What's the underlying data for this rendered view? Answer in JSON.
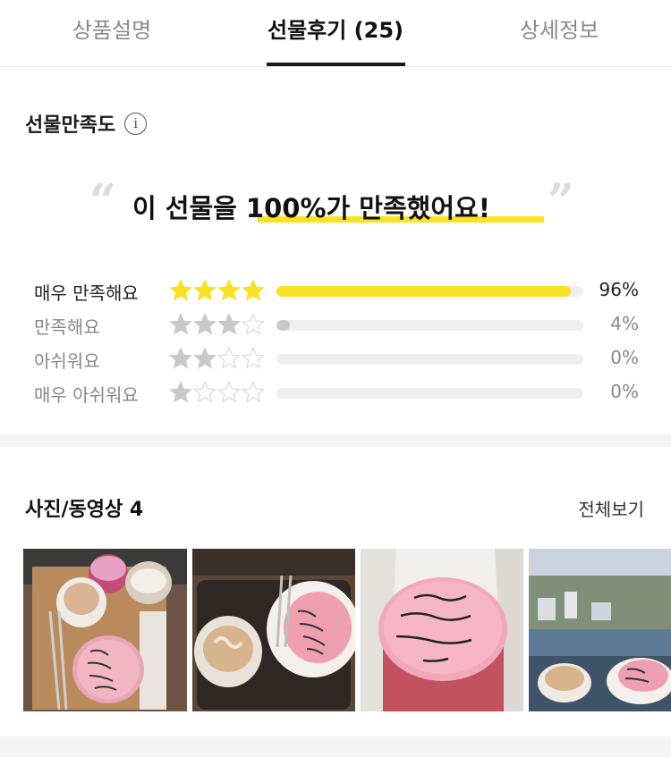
{
  "tabs": [
    {
      "label": "상품설명"
    },
    {
      "label": "선물후기 (25)"
    },
    {
      "label": "상세정보"
    }
  ],
  "satisfaction": {
    "title": "선물만족도",
    "info_icon": "info-icon",
    "headline_prefix": "이 선물을 ",
    "headline_emphasis": "100%가 만족했어요!",
    "open_quote": "“",
    "close_quote": "”",
    "accent_color": "#f7e224",
    "ratings": [
      {
        "label": "매우 만족해요",
        "stars": 4,
        "percent": 96,
        "percent_text": "96%"
      },
      {
        "label": "만족해요",
        "stars": 3,
        "percent": 4,
        "percent_text": "4%"
      },
      {
        "label": "아쉬워요",
        "stars": 2,
        "percent": 0,
        "percent_text": "0%"
      },
      {
        "label": "매우 아쉬워요",
        "stars": 1,
        "percent": 0,
        "percent_text": "0%"
      }
    ]
  },
  "photos": {
    "title": "사진/동영상 4",
    "see_all": "전체보기",
    "items": [
      {
        "alt": "cake-and-coffee-photo",
        "cake_text": "HAPPE BIRTH DAE HARRY"
      },
      {
        "alt": "cake-with-latte-photo",
        "cake_text": "HAPPE BIRTH DAE HARRY"
      },
      {
        "alt": "cake-closeup-photo",
        "cake_text": "HAPPE BIRTH DAE HARRY"
      },
      {
        "alt": "city-view-cafe-photo",
        "cake_text": "HAPPE BIRTH DAE HARRY"
      }
    ]
  }
}
